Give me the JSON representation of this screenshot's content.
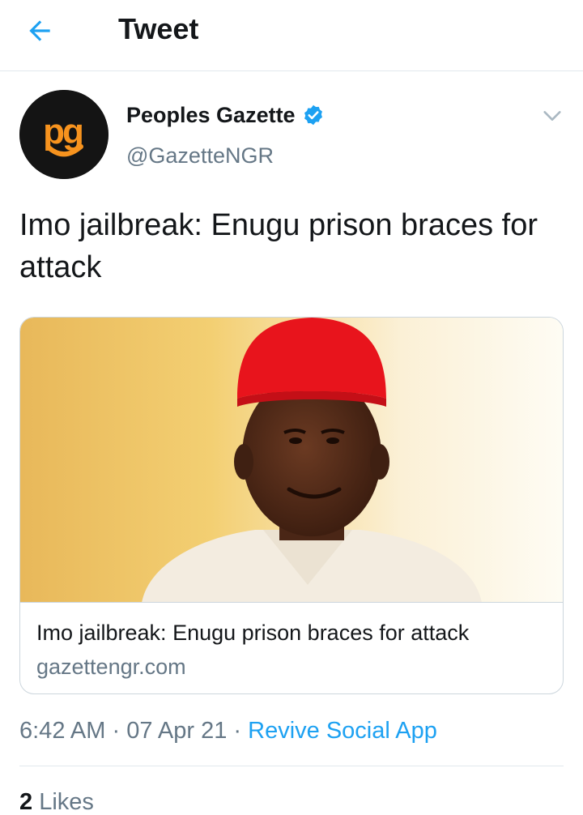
{
  "topbar": {
    "title": "Tweet",
    "back_icon": "arrow-left-icon",
    "accent": "#1da1f2"
  },
  "author": {
    "display_name": "Peoples Gazette",
    "handle": "@GazetteNGR",
    "avatar_text": "pg",
    "avatar_color": "#f7931e",
    "verified": true,
    "verified_icon": "verified-badge-icon",
    "more_icon": "chevron-down-icon"
  },
  "tweet": {
    "text": "Imo jailbreak: Enugu prison braces for attack"
  },
  "card": {
    "title": "Imo jailbreak: Enugu prison braces for attack",
    "domain": "gazettengr.com"
  },
  "meta": {
    "time": "6:42 AM",
    "separator": " · ",
    "date": "07 Apr 21",
    "source": "Revive Social App"
  },
  "stats": {
    "likes_count": "2",
    "likes_label": "Likes"
  }
}
